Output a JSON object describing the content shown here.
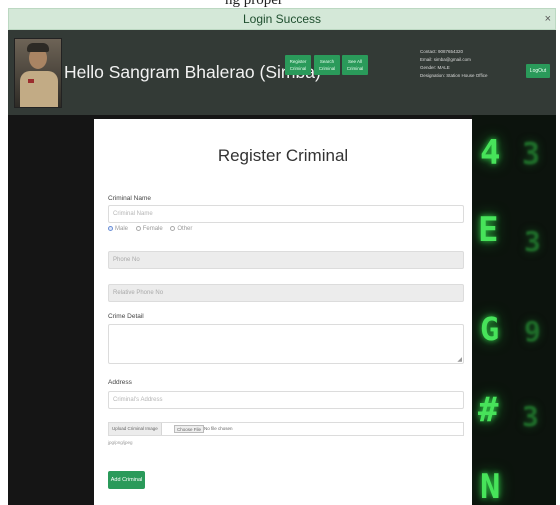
{
  "top_fragment": "ng proper",
  "alert": {
    "message": "Login Success",
    "close_glyph": "×"
  },
  "header": {
    "greeting": "Hello Sangram Bhalerao (Simba)",
    "nav": [
      {
        "line1": "Register",
        "line2": "Criminal"
      },
      {
        "line1": "Search",
        "line2": "Criminal"
      },
      {
        "line1": "See All",
        "line2": "Criminal"
      }
    ],
    "info": [
      "Contact: 9087654320",
      "Email: simba@gmail.com",
      "Gender: MALE",
      "Designation: Station House Office"
    ],
    "logout_label": "LogOut"
  },
  "form": {
    "title": "Register Criminal",
    "criminal_name_label": "Criminal Name",
    "criminal_name_placeholder": "Criminal Name",
    "gender_options": [
      "Male",
      "Female",
      "Other"
    ],
    "gender_selected": "Male",
    "phone_placeholder": "Phone No",
    "relative_phone_placeholder": "Relative Phone No",
    "crime_detail_label": "Crime Detail",
    "address_label": "Address",
    "address_placeholder": "Criminal's Address",
    "upload_label": "Upload Criminal Image",
    "choose_file_label": "Choose File",
    "no_file_text": "No file chosen",
    "file_hint": "jpg/png/jpeg",
    "submit_label": "Add Criminal"
  },
  "matrix_glyphs": [
    "4",
    "E",
    "G",
    "#",
    "N"
  ],
  "colors": {
    "accent_green": "#2a9a5a",
    "header_bg": "#333a36",
    "alert_bg": "#d4e8d8",
    "matrix_green": "#47e35a"
  }
}
